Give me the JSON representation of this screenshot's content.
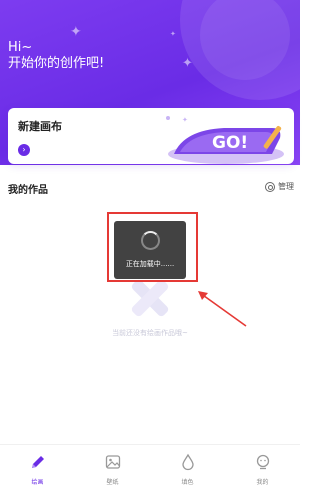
{
  "header": {
    "greeting_line1": "Hi~",
    "greeting_line2": "开始你的创作吧!"
  },
  "new_canvas": {
    "title": "新建画布",
    "art_text": "GO!"
  },
  "works": {
    "section_title": "我的作品",
    "manage_label": "管理",
    "empty_text": "当前还没有绘画作品哦~"
  },
  "loading": {
    "text": "正在加载中......"
  },
  "tabs": [
    {
      "label": "绘画",
      "icon": "pencil-icon",
      "active": true
    },
    {
      "label": "壁纸",
      "icon": "image-icon",
      "active": false
    },
    {
      "label": "填色",
      "icon": "drop-icon",
      "active": false
    },
    {
      "label": "我的",
      "icon": "profile-icon",
      "active": false
    }
  ],
  "colors": {
    "accent": "#6a2ce6",
    "hero_start": "#7d3cf0",
    "highlight": "#e53935"
  }
}
